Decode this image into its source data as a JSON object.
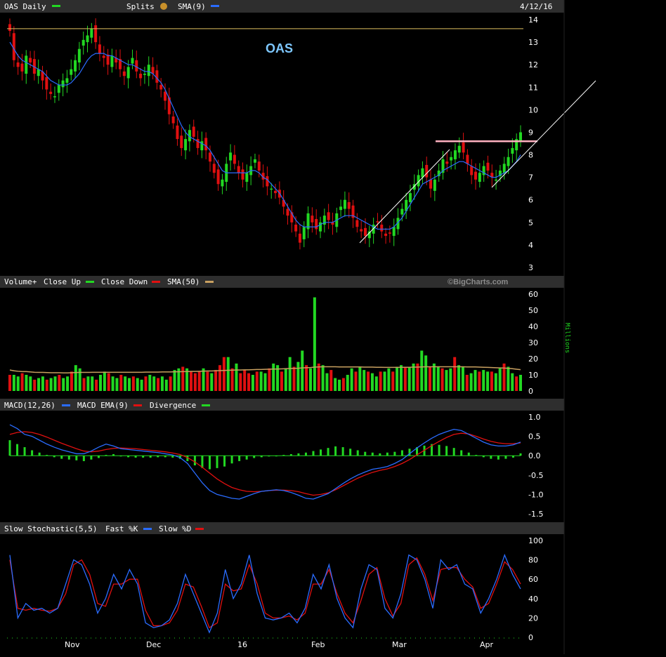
{
  "chart_data": [
    {
      "type": "candlestick",
      "title": "OAS Daily",
      "header_items": [
        "OAS Daily",
        "Splits",
        "SMA(9)"
      ],
      "date_label": "4/12/16",
      "annotation": "OAS",
      "ylim": [
        3,
        14
      ],
      "y_ticks": [
        3,
        4,
        5,
        6,
        7,
        8,
        9,
        10,
        11,
        12,
        13,
        14
      ],
      "resistance_price": 13.6,
      "breakout_line_price": 8.6,
      "closes": [
        13.5,
        12.2,
        11.9,
        11.7,
        12.4,
        12.1,
        11.6,
        11.8,
        11.3,
        10.9,
        10.7,
        10.6,
        11.1,
        11.3,
        11.4,
        11.8,
        12.2,
        12.7,
        13.1,
        13.3,
        13.6,
        13.0,
        12.5,
        12.3,
        12.0,
        12.4,
        12.1,
        11.8,
        11.5,
        11.9,
        12.3,
        11.7,
        11.4,
        11.6,
        12.0,
        11.6,
        11.2,
        10.9,
        10.4,
        9.8,
        9.4,
        8.7,
        8.3,
        8.7,
        9.1,
        8.8,
        8.3,
        8.6,
        8.2,
        7.7,
        7.2,
        6.7,
        6.9,
        7.6,
        8.1,
        7.6,
        7.2,
        6.9,
        7.2,
        7.5,
        7.8,
        7.3,
        6.9,
        6.6,
        6.5,
        6.3,
        6.1,
        5.7,
        5.3,
        5.0,
        4.6,
        4.1,
        4.8,
        5.4,
        5.0,
        4.7,
        5.0,
        5.3,
        5.1,
        4.9,
        5.4,
        5.7,
        6.0,
        5.6,
        5.2,
        4.8,
        4.6,
        4.4,
        4.6,
        4.9,
        5.0,
        4.6,
        4.4,
        4.5,
        4.8,
        5.2,
        5.6,
        6.0,
        6.3,
        6.7,
        7.1,
        7.4,
        7.0,
        6.5,
        6.9,
        7.3,
        7.8,
        7.6,
        7.9,
        8.2,
        8.4,
        8.1,
        7.6,
        7.1,
        6.9,
        7.2,
        7.5,
        7.3,
        7.0,
        6.9,
        7.3,
        7.6,
        7.9,
        8.3,
        8.7,
        9.0
      ],
      "sma9": [
        13.0,
        12.7,
        12.4,
        12.2,
        12.1,
        12.0,
        11.9,
        11.8,
        11.7,
        11.5,
        11.3,
        11.2,
        11.1,
        11.1,
        11.1,
        11.2,
        11.4,
        11.6,
        11.9,
        12.2,
        12.4,
        12.5,
        12.5,
        12.5,
        12.4,
        12.4,
        12.3,
        12.2,
        12.1,
        12.0,
        12.0,
        11.9,
        11.8,
        11.7,
        11.7,
        11.6,
        11.4,
        11.2,
        10.9,
        10.5,
        10.1,
        9.7,
        9.3,
        9.0,
        8.8,
        8.7,
        8.6,
        8.5,
        8.4,
        8.2,
        7.9,
        7.6,
        7.3,
        7.2,
        7.2,
        7.2,
        7.2,
        7.2,
        7.2,
        7.3,
        7.3,
        7.2,
        7.0,
        6.9,
        6.7,
        6.5,
        6.3,
        6.0,
        5.7,
        5.4,
        5.1,
        4.9,
        4.8,
        4.8,
        4.8,
        4.8,
        4.9,
        5.0,
        5.0,
        5.0,
        5.1,
        5.2,
        5.3,
        5.3,
        5.3,
        5.2,
        5.1,
        5.0,
        4.9,
        4.8,
        4.7,
        4.7,
        4.7,
        4.7,
        4.8,
        5.0,
        5.2,
        5.5,
        5.8,
        6.1,
        6.4,
        6.7,
        6.8,
        6.9,
        7.0,
        7.1,
        7.3,
        7.4,
        7.5,
        7.6,
        7.7,
        7.7,
        7.6,
        7.5,
        7.4,
        7.3,
        7.2,
        7.1,
        7.0,
        7.0,
        7.1,
        7.2,
        7.3,
        7.5,
        7.7,
        8.0
      ]
    },
    {
      "type": "bar",
      "title": "Volume+",
      "header_items": [
        "Volume+",
        "Close Up",
        "Close Down",
        "SMA(50)"
      ],
      "axis_label": "Millions",
      "ylim": [
        0,
        60
      ],
      "y_ticks": [
        0,
        10,
        20,
        30,
        40,
        50,
        60
      ],
      "values": [
        10,
        10,
        9,
        11,
        10,
        9,
        7,
        8,
        9,
        7,
        8,
        9,
        10,
        8,
        9,
        12,
        16,
        14,
        8,
        9,
        9,
        7,
        10,
        12,
        11,
        9,
        8,
        10,
        9,
        8,
        9,
        8,
        7,
        9,
        10,
        9,
        8,
        9,
        7,
        9,
        13,
        14,
        15,
        14,
        12,
        11,
        12,
        14,
        12,
        11,
        13,
        16,
        21,
        21,
        14,
        17,
        11,
        13,
        11,
        10,
        12,
        12,
        11,
        14,
        17,
        16,
        12,
        14,
        21,
        15,
        18,
        25,
        16,
        14,
        58,
        17,
        16,
        11,
        13,
        8,
        7,
        8,
        10,
        14,
        12,
        15,
        13,
        12,
        11,
        9,
        12,
        12,
        14,
        12,
        15,
        16,
        15,
        15,
        17,
        17,
        25,
        22,
        15,
        17,
        15,
        14,
        13,
        14,
        21,
        16,
        15,
        10,
        11,
        13,
        12,
        13,
        12,
        12,
        11,
        14,
        17,
        15,
        11,
        9,
        10
      ],
      "sma50": [
        13,
        12.5,
        12.2,
        12,
        12,
        11.8,
        11.6,
        11.5,
        11.5,
        11.4,
        11.3,
        11.3,
        11.3,
        11.2,
        11.2,
        11.3,
        11.4,
        11.5,
        11.5,
        11.5,
        11.6,
        11.6,
        11.6,
        11.6,
        11.6,
        11.6,
        11.6,
        11.6,
        11.6,
        11.6,
        11.6,
        11.6,
        11.6,
        11.7,
        11.7,
        11.7,
        11.7,
        11.8,
        11.8,
        11.8,
        11.9,
        11.9,
        12,
        12,
        12.1,
        12.1,
        12.2,
        12.3,
        12.4,
        12.4,
        12.5,
        12.6,
        12.7,
        12.8,
        12.9,
        13,
        13,
        13.1,
        13.1,
        13.2,
        13.3,
        13.3,
        13.4,
        13.5,
        13.6,
        13.6,
        13.7,
        13.8,
        13.9,
        14,
        14.1,
        14.3,
        14.4,
        14.5,
        14.8,
        14.9,
        15,
        15,
        15,
        15,
        14.9,
        14.9,
        14.9,
        14.9,
        14.9,
        14.9,
        14.8,
        14.8,
        14.8,
        14.7,
        14.7,
        14.6,
        14.6,
        14.6,
        14.6,
        14.7,
        14.7,
        14.7,
        14.8,
        14.8,
        14.9,
        15,
        15,
        15,
        15,
        15,
        15,
        15,
        15,
        15,
        15,
        14.9,
        14.9,
        14.9,
        14.8,
        14.7,
        14.6,
        14.5,
        14.4,
        14.3,
        14.2,
        14,
        13.8,
        13.5,
        13.2
      ]
    },
    {
      "type": "line",
      "title": "MACD(12,26)",
      "header_items": [
        "MACD(12,26)",
        "MACD EMA(9)",
        "Divergence"
      ],
      "ylim": [
        -1.5,
        1.0
      ],
      "y_ticks": [
        1.0,
        0.5,
        0.0,
        -0.5,
        -1.0,
        -1.5
      ],
      "series": [
        {
          "name": "MACD(12,26)",
          "values": [
            0.8,
            0.7,
            0.55,
            0.5,
            0.4,
            0.3,
            0.22,
            0.15,
            0.1,
            0.05,
            0.05,
            0.12,
            0.22,
            0.3,
            0.25,
            0.18,
            0.16,
            0.14,
            0.12,
            0.1,
            0.08,
            0.05,
            0.02,
            -0.05,
            -0.2,
            -0.45,
            -0.7,
            -0.9,
            -1.0,
            -1.05,
            -1.1,
            -1.12,
            -1.05,
            -0.98,
            -0.92,
            -0.9,
            -0.88,
            -0.9,
            -0.95,
            -1.02,
            -1.1,
            -1.12,
            -1.05,
            -0.98,
            -0.85,
            -0.72,
            -0.6,
            -0.5,
            -0.42,
            -0.35,
            -0.32,
            -0.28,
            -0.2,
            -0.1,
            0.05,
            0.2,
            0.33,
            0.45,
            0.55,
            0.62,
            0.68,
            0.65,
            0.55,
            0.45,
            0.35,
            0.28,
            0.25,
            0.25,
            0.28,
            0.35
          ]
        },
        {
          "name": "MACD EMA(9)",
          "values": [
            0.55,
            0.6,
            0.62,
            0.6,
            0.55,
            0.48,
            0.4,
            0.32,
            0.25,
            0.18,
            0.12,
            0.1,
            0.12,
            0.16,
            0.19,
            0.2,
            0.19,
            0.18,
            0.16,
            0.14,
            0.12,
            0.1,
            0.07,
            0.03,
            -0.05,
            -0.16,
            -0.3,
            -0.45,
            -0.6,
            -0.72,
            -0.82,
            -0.88,
            -0.92,
            -0.93,
            -0.92,
            -0.9,
            -0.89,
            -0.89,
            -0.9,
            -0.93,
            -0.98,
            -1.02,
            -1.0,
            -0.96,
            -0.88,
            -0.78,
            -0.68,
            -0.58,
            -0.5,
            -0.43,
            -0.38,
            -0.34,
            -0.28,
            -0.2,
            -0.1,
            0.02,
            0.14,
            0.26,
            0.37,
            0.47,
            0.55,
            0.58,
            0.56,
            0.5,
            0.43,
            0.37,
            0.33,
            0.31,
            0.31,
            0.33
          ]
        }
      ],
      "divergence": [
        0.4,
        0.3,
        0.22,
        0.14,
        0.08,
        0.02,
        -0.04,
        -0.08,
        -0.1,
        -0.12,
        -0.14,
        -0.1,
        -0.06,
        0.02,
        0.04,
        -0.02,
        -0.04,
        -0.05,
        -0.05,
        -0.05,
        -0.04,
        -0.04,
        -0.05,
        -0.08,
        -0.14,
        -0.25,
        -0.32,
        -0.35,
        -0.32,
        -0.28,
        -0.2,
        -0.14,
        -0.1,
        -0.06,
        -0.04,
        -0.02,
        0.0,
        0.02,
        0.04,
        0.06,
        0.08,
        0.12,
        0.16,
        0.2,
        0.24,
        0.22,
        0.18,
        0.14,
        0.1,
        0.08,
        0.06,
        0.08,
        0.1,
        0.14,
        0.18,
        0.22,
        0.26,
        0.3,
        0.28,
        0.25,
        0.2,
        0.14,
        0.08,
        0.02,
        -0.04,
        -0.08,
        -0.1,
        -0.08,
        -0.05,
        0.06
      ]
    },
    {
      "type": "line",
      "title": "Slow Stochastic(5,5)",
      "header_items": [
        "Slow Stochastic(5,5)",
        "Fast %K",
        "Slow %D"
      ],
      "ylim": [
        0,
        100
      ],
      "y_ticks": [
        100,
        80,
        60,
        40,
        20,
        0
      ],
      "series": [
        {
          "name": "Fast %K",
          "values": [
            85,
            20,
            35,
            28,
            30,
            25,
            30,
            55,
            80,
            75,
            55,
            25,
            40,
            65,
            50,
            70,
            55,
            15,
            10,
            12,
            18,
            35,
            65,
            45,
            25,
            5,
            25,
            70,
            40,
            55,
            85,
            45,
            20,
            18,
            20,
            25,
            15,
            30,
            65,
            50,
            75,
            40,
            20,
            10,
            50,
            75,
            70,
            30,
            20,
            45,
            85,
            80,
            60,
            30,
            80,
            70,
            75,
            55,
            50,
            25,
            40,
            60,
            85,
            65,
            50
          ]
        },
        {
          "name": "Slow %D",
          "values": [
            80,
            30,
            28,
            30,
            28,
            27,
            30,
            45,
            75,
            80,
            65,
            35,
            32,
            55,
            55,
            60,
            60,
            28,
            12,
            12,
            15,
            28,
            55,
            52,
            32,
            10,
            15,
            55,
            48,
            50,
            75,
            55,
            25,
            20,
            20,
            22,
            18,
            25,
            55,
            55,
            70,
            45,
            25,
            15,
            38,
            65,
            72,
            40,
            22,
            35,
            75,
            82,
            65,
            38,
            70,
            72,
            72,
            60,
            52,
            30,
            35,
            55,
            78,
            70,
            55
          ]
        }
      ]
    }
  ],
  "x_axis": {
    "labels": [
      "Nov",
      "Dec",
      "16",
      "Feb",
      "Mar",
      "Apr"
    ]
  },
  "brand": "©BigCharts.com",
  "colors": {
    "up": "#22d822",
    "down": "#e01010",
    "sma": "#2a6cff",
    "macd_ema": "#e01010",
    "divergence": "#22d822",
    "vol_sma": "#c8a060",
    "resistance": "#e0c060",
    "breakout": "#ffb0c0",
    "header_bg": "#2e2e2e"
  }
}
